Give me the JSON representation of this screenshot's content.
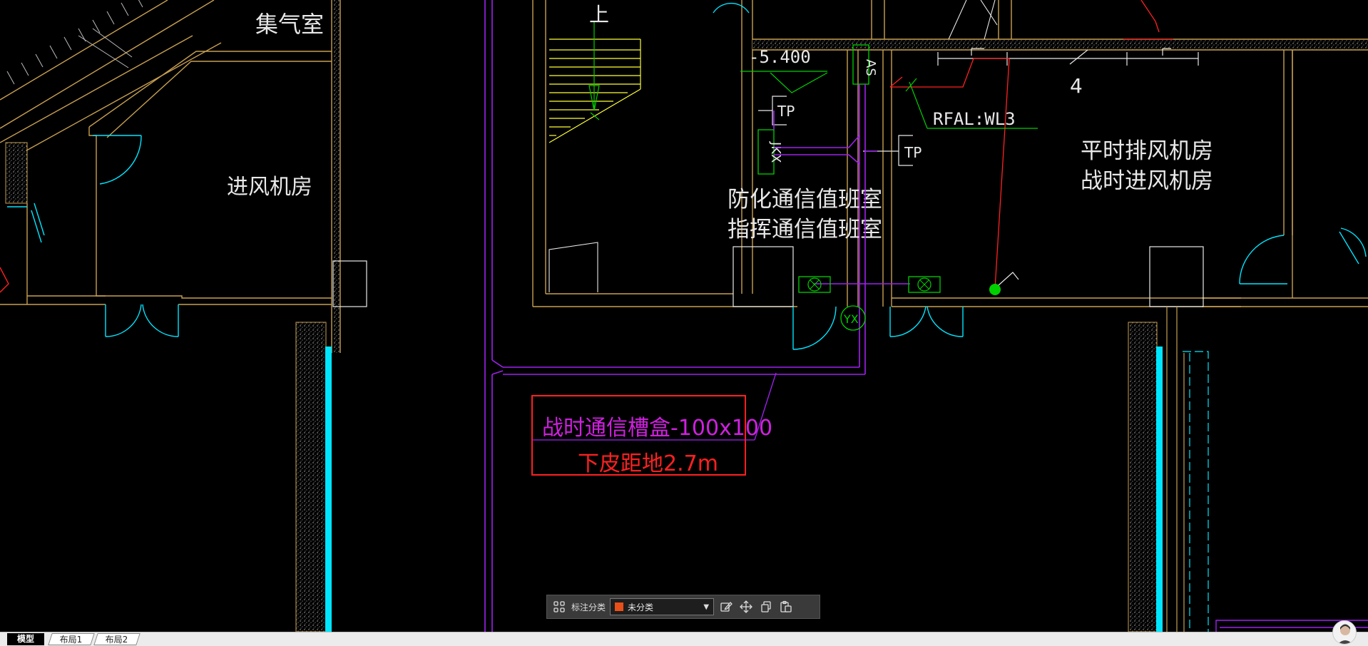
{
  "drawing": {
    "rooms": {
      "air_chamber": "集气室",
      "intake_room": "进风机房",
      "comm_duty_1": "防化通信值班室",
      "comm_duty_2": "指挥通信值班室",
      "exhaust_1": "平时排风机房",
      "exhaust_2": "战时进风机房",
      "stair_up": "上"
    },
    "labels": {
      "elevation": "-5.400",
      "as_box": "AS",
      "jkx_box": "JKX",
      "tp_1": "TP",
      "tp_2": "TP",
      "yx": "YX",
      "cable": "RFAL:WL3",
      "count": "4",
      "callout_line1": "战时通信槽盒-100x100",
      "callout_line2": "下皮距地2.7m"
    },
    "colors": {
      "wall": "#c8a050",
      "pipe": "#a020f0",
      "cyan": "#00e5ff",
      "green": "#00d000",
      "red": "#ff2020",
      "white": "#e8e8e8"
    }
  },
  "toolbar": {
    "label": "标注分类",
    "category_value": "未分类",
    "category_color": "#e8501a",
    "icons": [
      "grid-icon",
      "edit-icon",
      "move-icon",
      "copy-icon",
      "paste-icon"
    ]
  },
  "tabs": [
    {
      "label": "模型"
    },
    {
      "label": "布局1"
    },
    {
      "label": "布局2"
    }
  ]
}
